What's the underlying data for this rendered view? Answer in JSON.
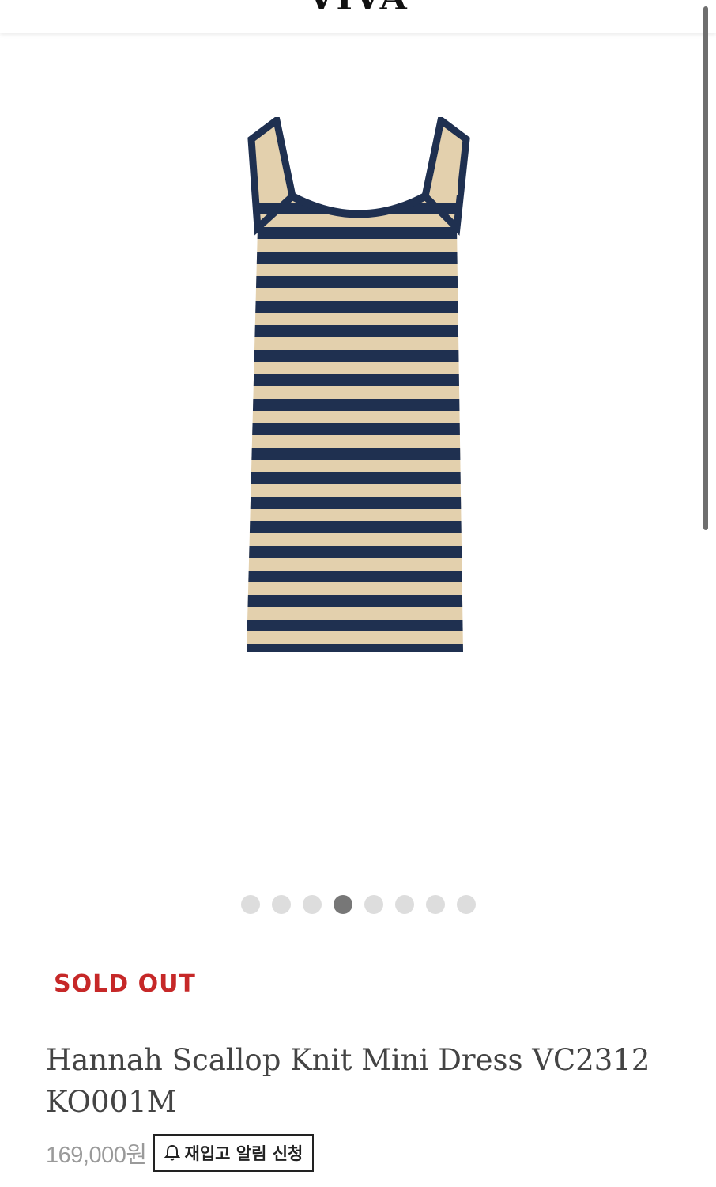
{
  "header": {
    "logo": "VIVA"
  },
  "gallery": {
    "image_alt": "Striped navy and beige knit mini dress",
    "dots_total": 8,
    "active_index": 3
  },
  "product": {
    "status": "SOLD OUT",
    "status_color": "#c62828",
    "name": "Hannah Scallop Knit Mini Dress VC2312KO001M",
    "price": "169,000원",
    "restock_button": {
      "label": "재입고 알림 신청",
      "icon": "bell-icon"
    }
  },
  "colors": {
    "stripe_navy": "#1f3050",
    "stripe_beige": "#e3d0ad"
  }
}
